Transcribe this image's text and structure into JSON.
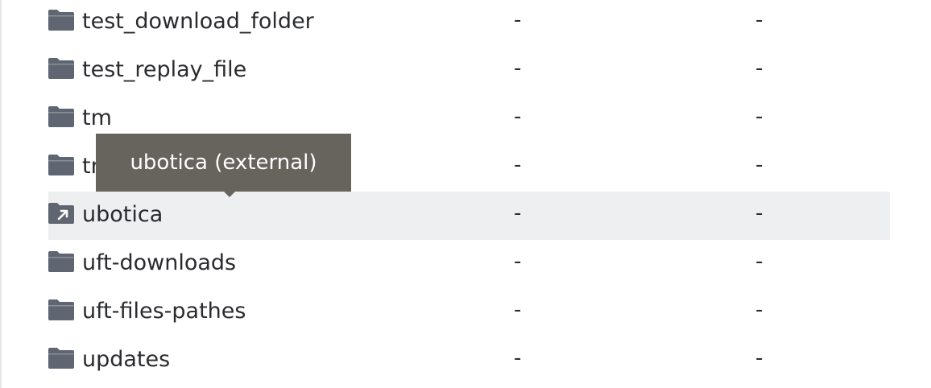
{
  "files": [
    {
      "name": "test_download_folder",
      "col_a": "-",
      "col_b": "-",
      "icon": "folder-icon"
    },
    {
      "name": "test_replay_file",
      "col_a": "-",
      "col_b": "-",
      "icon": "folder-icon"
    },
    {
      "name": "tm",
      "col_a": "-",
      "col_b": "-",
      "icon": "folder-icon"
    },
    {
      "name": "tr",
      "col_a": "-",
      "col_b": "-",
      "icon": "folder-icon"
    },
    {
      "name": "ubotica",
      "col_a": "-",
      "col_b": "-",
      "icon": "external-folder-icon"
    },
    {
      "name": "uft-downloads",
      "col_a": "-",
      "col_b": "-",
      "icon": "folder-icon"
    },
    {
      "name": "uft-files-pathes",
      "col_a": "-",
      "col_b": "-",
      "icon": "folder-icon"
    },
    {
      "name": "updates",
      "col_a": "-",
      "col_b": "-",
      "icon": "folder-icon"
    }
  ],
  "tooltip": {
    "text": "ubotica (external)"
  },
  "colors": {
    "folder_icon": "#5f6672",
    "row_hover": "#eeeff1",
    "tooltip_bg": "#67645e",
    "text": "#2a2b2e"
  }
}
